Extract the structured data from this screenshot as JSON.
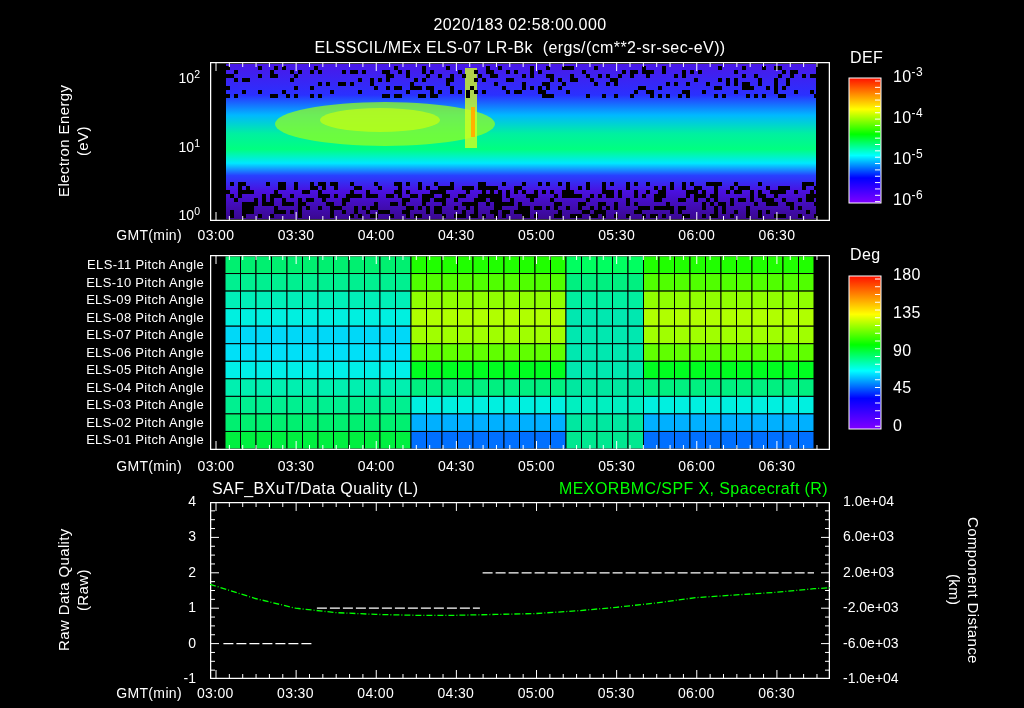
{
  "header": {
    "timestamp": "2020/183 02:58:00.000",
    "title": "ELSSCIL/MEx ELS-07 LR-Bk  (ergs/(cm**2-sr-sec-eV))"
  },
  "spectrogram": {
    "ylabel": "Electron Energy (eV)",
    "yticks": [
      "10$^{2}$",
      "10$^{1}$",
      "10$^{0}$"
    ],
    "xlabel": "GMT(min)",
    "xticks": [
      "03:00",
      "03:30",
      "04:00",
      "04:30",
      "05:00",
      "05:30",
      "06:00",
      "06:30"
    ],
    "colorbar": {
      "title": "DEF",
      "labels": [
        "10$^{-3}$",
        "10$^{-4}$",
        "10$^{-5}$",
        "10$^{-6}$"
      ]
    }
  },
  "pitch_angle": {
    "rows": [
      "ELS-11 Pitch Angle",
      "ELS-10 Pitch Angle",
      "ELS-09 Pitch Angle",
      "ELS-08 Pitch Angle",
      "ELS-07 Pitch Angle",
      "ELS-06 Pitch Angle",
      "ELS-05 Pitch Angle",
      "ELS-04 Pitch Angle",
      "ELS-03 Pitch Angle",
      "ELS-02 Pitch Angle",
      "ELS-01 Pitch Angle"
    ],
    "xlabel": "GMT(min)",
    "xticks": [
      "03:00",
      "03:30",
      "04:00",
      "04:30",
      "05:00",
      "05:30",
      "06:00",
      "06:30"
    ],
    "colorbar": {
      "title": "Deg",
      "labels": [
        "180",
        "135",
        "90",
        "45",
        "0"
      ]
    }
  },
  "data_quality": {
    "left": {
      "chart_data": {
        "type": "line",
        "xlabel": "GMT(min)",
        "ylabel": "Raw Data Quality (Raw)",
        "x": [
          183,
          217,
          218,
          279,
          280,
          404
        ],
        "xlim": [
          178,
          410
        ],
        "ylim": [
          -1,
          4
        ],
        "yticks": [
          -1,
          0,
          1,
          2,
          3,
          4
        ],
        "xticks": [
          {
            "value": 180,
            "label": "03:00"
          },
          {
            "value": 210,
            "label": "03:30"
          },
          {
            "value": 240,
            "label": "04:00"
          },
          {
            "value": 270,
            "label": "04:30"
          },
          {
            "value": 300,
            "label": "05:00"
          },
          {
            "value": 330,
            "label": "05:30"
          },
          {
            "value": 360,
            "label": "06:00"
          },
          {
            "value": 390,
            "label": "06:30"
          }
        ],
        "series": [
          {
            "name": "SAF_BXuT/Data Quality (L)",
            "color": "#ffffff",
            "line_style": "dashed",
            "values": [
              0,
              0,
              1,
              1,
              2,
              2
            ]
          }
        ]
      }
    },
    "right": {
      "chart_data": {
        "type": "line",
        "ylabel": "Component Distance (km)",
        "x": [
          178,
          195,
          210,
          225,
          240,
          255,
          270,
          285,
          300,
          315,
          330,
          345,
          360,
          375,
          390,
          404,
          410
        ],
        "xlim": [
          178,
          410
        ],
        "ylim": [
          -10000,
          10000
        ],
        "yticks": [
          {
            "value": 10000,
            "label": "1.0e+04"
          },
          {
            "value": 6000,
            "label": "6.0e+03"
          },
          {
            "value": 2000,
            "label": "2.0e+03"
          },
          {
            "value": -2000,
            "label": "-2.0e+03"
          },
          {
            "value": -6000,
            "label": "-6.0e+03"
          },
          {
            "value": -10000,
            "label": "-1.0e+04"
          }
        ],
        "series": [
          {
            "name": "MEXORBMC/SPF X, Spacecraft (R)",
            "color": "#00ff00",
            "line_style": "dashdot",
            "values": [
              700,
              -900,
              -2000,
              -2500,
              -2700,
              -2800,
              -2800,
              -2700,
              -2600,
              -2300,
              -1900,
              -1400,
              -800,
              -500,
              -200,
              200,
              300
            ]
          }
        ]
      }
    }
  }
}
